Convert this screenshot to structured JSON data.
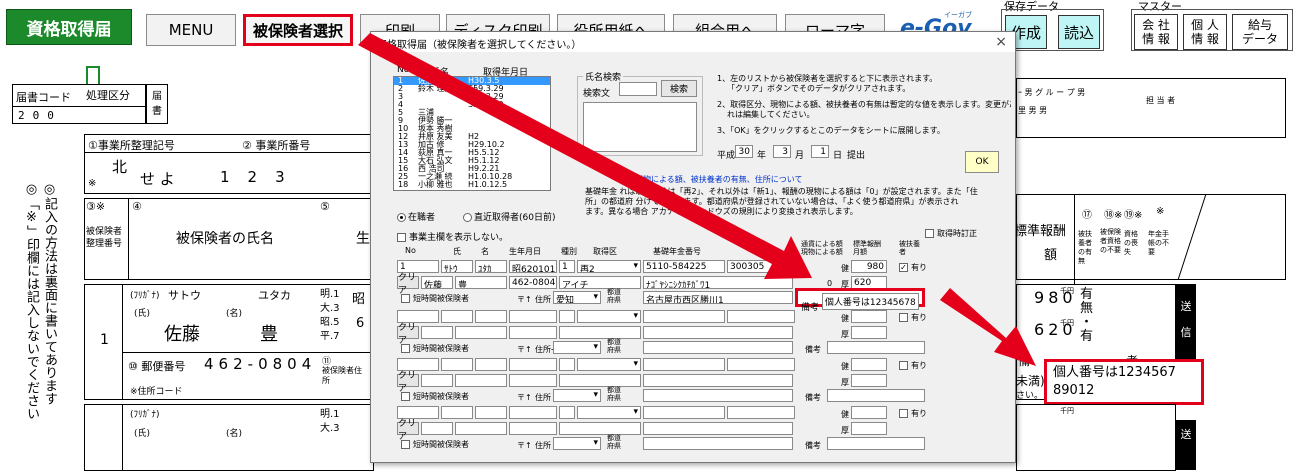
{
  "toolbar": {
    "title": "資格取得届",
    "menu": "MENU",
    "select_insured": "被保険者選択",
    "print": "印刷",
    "disk_print": "ディスク印刷",
    "official_form": "役所用紙へ",
    "union_form": "組合用へ",
    "roman": "ローマ字",
    "logo": "e-Gov",
    "logo_sub": "イーガブ",
    "save_group": "保存データ",
    "create": "作成",
    "read": "読込",
    "master_group": "マスター",
    "company_info": [
      "会 社",
      "情 報"
    ],
    "personal_info": [
      "個 人",
      "情 報"
    ],
    "salary_data": [
      "給与",
      "データ"
    ]
  },
  "form": {
    "code_label": "届書コード",
    "division_label": "処理区分",
    "code_digits": [
      "2",
      "0",
      "0"
    ],
    "todoke": [
      "届",
      "書"
    ],
    "office_ref_label": "①事業所整理記号",
    "office_no_label": "② 事業所番号",
    "office_ref_value_1": "北",
    "office_ref_mark": "※",
    "office_ref_value_2": "せ よ",
    "office_no_digits": [
      "1",
      "2",
      "3"
    ],
    "note_vertical": "◎記入の方法は裏面に書いてあります",
    "note_vertical_2": "◎「※」印欄には記入しないでください",
    "col3_label": "③※",
    "col4_label": "④",
    "col5_label": "⑤",
    "seiri_label": "被保険者整理番号",
    "name_label": "被保険者の氏名",
    "birth_label": "生",
    "row1_no": "1",
    "furigana_label": "(ﾌﾘｶﾞﾅ)",
    "furigana_sei": "サトウ",
    "furigana_mei": "ユタカ",
    "shi_label": "(氏)",
    "mei_label": "(名)",
    "sei_kanji": "佐藤",
    "mei_kanji": "豊",
    "eras": [
      "明.1",
      "大.3",
      "昭.5",
      "平.7"
    ],
    "era_char": "昭",
    "era_char_2": "6",
    "postal_label": "⑩ 郵便番号",
    "postal_digits": [
      "4",
      "6",
      "2",
      "0",
      "8",
      "0",
      "4"
    ],
    "address_code_label": "※住所コード",
    "col11": "⑪",
    "col11_label": "被保険者住所",
    "eras_2": [
      "明.1",
      "大.3"
    ],
    "furigana_label_2": "(ﾌﾘｶﾞﾅ)",
    "shi_label_2": "(氏)",
    "mei_label_2": "(名)",
    "right_header": "ｰ 男 グ ル ー プ 男",
    "right_header_2": "里 男 男",
    "right_header_3": "担 当 者",
    "monthly_label": "標準報酬",
    "monthly_label_2": "額",
    "col_labels": [
      "⑰",
      "⑱※",
      "⑲※",
      "※"
    ],
    "col_texts": [
      "被扶養者の有無",
      "被保険者資格の不要",
      "資格の喪失",
      "年金手帳の不要"
    ],
    "amount_row1": [
      "9",
      "8",
      "0"
    ],
    "amount_row2": [
      "6",
      "2",
      "0"
    ],
    "sen_en": "千円",
    "sen_en_2": "千円",
    "sen_en_3": "千円",
    "yes": "有",
    "no": "無",
    "dot": "・",
    "yes2": "有",
    "send": "送",
    "send_2": "信",
    "send_3": "送",
    "biko_partial": "備",
    "biko_partial_2": "考",
    "under_label": "未満)",
    "under_label_2": "さい。",
    "my_number_note": [
      "個人番号は1234567",
      "89012"
    ]
  },
  "dialog": {
    "title": "資格取得届（被保険者を選択してください。）",
    "close": "×",
    "list_headers": {
      "no": "No",
      "name": "氏名",
      "date": "取得年月日"
    },
    "list_rows": [
      {
        "no": "1",
        "name": "佐藤 豊",
        "date": "H30.3.5",
        "selected": true
      },
      {
        "no": "2",
        "name": "鈴木 理恵子",
        "date": "S59.3.29",
        "selected": false
      },
      {
        "no": "3",
        "name": "",
        "date": "S59.3.29",
        "selected": false
      },
      {
        "no": "4",
        "name": "",
        "date": "S59.3.29",
        "selected": false
      },
      {
        "no": "5",
        "name": "三浦",
        "date": "",
        "selected": false
      },
      {
        "no": "9",
        "name": "伊勢 勝一",
        "date": "",
        "selected": false
      },
      {
        "no": "10",
        "name": "坂本 秀樹",
        "date": "",
        "selected": false
      },
      {
        "no": "12",
        "name": "井原 友美",
        "date": "H2",
        "selected": false
      },
      {
        "no": "13",
        "name": "加古 修",
        "date": "H29.10.2",
        "selected": false
      },
      {
        "no": "14",
        "name": "荻原 真一",
        "date": "H5.5.12",
        "selected": false
      },
      {
        "no": "15",
        "name": "大石 弘文",
        "date": "H5.1.12",
        "selected": false
      },
      {
        "no": "16",
        "name": "西 浩司",
        "date": "H9.2.21",
        "selected": false
      },
      {
        "no": "25",
        "name": "一之瀬 続",
        "date": "H1.0.10.28",
        "selected": false
      },
      {
        "no": "18",
        "name": "小柳 雅也",
        "date": "H1.0.12.5",
        "selected": false
      }
    ],
    "search_group": "氏名検索",
    "search_label": "検索文",
    "search_button": "検索",
    "instructions": [
      "1、左のリストから被保険者を選択すると下に表示されます。",
      "「クリア」ボタンでそのデータがクリアされます。",
      "2、取得区分、現物による額、被扶養者の有無は暫定的な値を表示します。変更があ",
      "れは編集してください。",
      "3、「OK」をクリックするとこのデータをシートに展開します。"
    ],
    "date_prefix": "平成",
    "year": "30",
    "year_label": "年",
    "month": "3",
    "month_label": "月",
    "day": "1",
    "day_label": "日",
    "submit_label": "提出",
    "ok": "OK",
    "link_text": "現物による額、被扶養者の有無、住所について",
    "explain": [
      "基礎年金                                     れば取得区分は「再2」、それ以外は「新1」、報酬の現物による額は「0」が設定されます。また「住",
      "所」の都道府                               分けて表示します。都道府県が登録されていない場合は、「よく使う都道府県」が表示され",
      "ます。異なる場合                               アカナもウィンドウズの規則により変換され表示します。"
    ],
    "radio_employed": "在職者",
    "radio_recent": "直近取得者(60日前)",
    "chk_owner": "事業主欄を表示しない。",
    "chk_correction": "取得時訂正",
    "grid_headers": {
      "no": "No",
      "sei": "氏",
      "mei": "名",
      "birth": "生年月日",
      "kind": "種別",
      "acq": "取得区",
      "pension": "基礎年金番号",
      "currency": "通貨による額",
      "inkind": "現物による額",
      "standard": "標準報酬月額",
      "dependents": "被扶養者"
    },
    "row1": {
      "no": "1",
      "kana_sei": "ｻﾄｳ",
      "kana_mei": "ﾕﾀｶ",
      "birth": "昭620101",
      "kind": "1",
      "acq": "再2",
      "pension": "5110-584225",
      "currency": "300305",
      "ken_label": "健",
      "ken": "980",
      "kou_label": "厚",
      "kou": "620",
      "inkind": "0",
      "dep_label": "有り",
      "dep_checked": true,
      "clear": "クリア",
      "sei": "佐藤",
      "mei": "豊",
      "postal": "462-0804",
      "pref_kana": "アイチ",
      "addr_kana": "ﾅｺﾞﾔｼﾆｼｸｶﾁｶﾞﾜ1",
      "pref_mark": "〒↑",
      "addr_label": "住所",
      "pref": "愛知",
      "pref_label": "都道府県",
      "addr": "名古屋市西区勝川1",
      "short_time": "短時間被保険者",
      "biko_label": "備考",
      "biko": "個人番号は12345678"
    },
    "row_common": {
      "clear": "クリア",
      "short_time": "短時間被保険者",
      "pref_mark": "〒↑",
      "addr_label": "住所→",
      "addr_label_2": "住所",
      "pref_label": "都道府県",
      "biko_label": "備考",
      "ken_label": "健",
      "kou_label": "厚",
      "dep_label": "有り"
    }
  }
}
